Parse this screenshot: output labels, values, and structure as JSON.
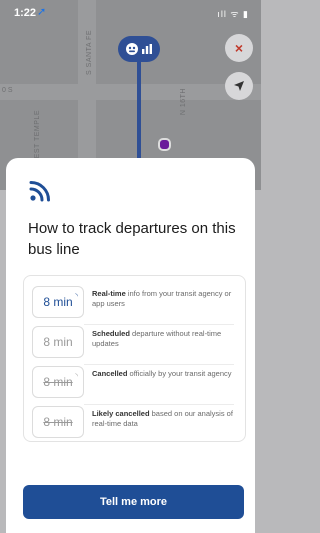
{
  "status_bar": {
    "time": "1:22",
    "location_arrow": "➚",
    "icons": "ıll ᯤ ▮"
  },
  "map": {
    "street_labels": [
      "N 16TH",
      "S SANTA FE",
      "S WEST TEMPLE"
    ],
    "left_label": "0 S",
    "bus_pin_icons": [
      "bus-face-icon",
      "signal-bars-icon"
    ],
    "close_button_label": "×",
    "locate_button_label": "➤",
    "accent_color": "#2f4f95"
  },
  "sheet": {
    "title": "How to track departures on this bus line",
    "legend": [
      {
        "badge": "8 min",
        "badge_style": "realtime",
        "desc_bold": "Real-time",
        "desc_rest": " info from your transit agency or app users"
      },
      {
        "badge": "8 min",
        "badge_style": "scheduled",
        "desc_bold": "Scheduled",
        "desc_rest": " departure without real-time updates"
      },
      {
        "badge": "8 min",
        "badge_style": "cancelled-official",
        "desc_bold": "Cancelled",
        "desc_rest": " officially by your transit agency"
      },
      {
        "badge": "8 min",
        "badge_style": "cancelled-likely",
        "desc_bold": "Likely cancelled",
        "desc_rest": " based on our analysis of real-time data"
      }
    ],
    "cta_label": "Tell me more",
    "cta_color": "#1f4e96"
  }
}
